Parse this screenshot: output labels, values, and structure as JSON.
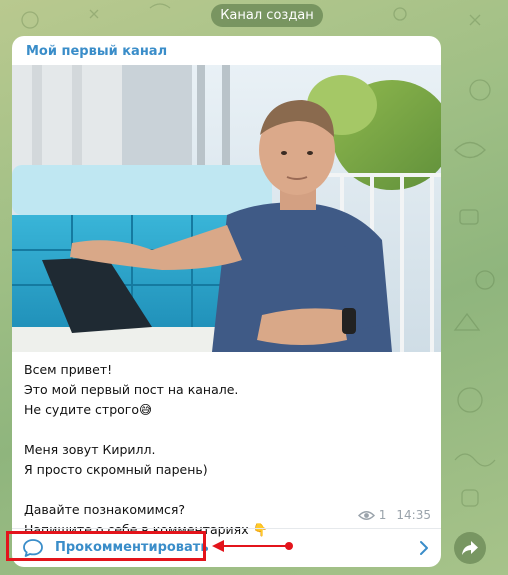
{
  "service_message": "Канал создан",
  "post": {
    "channel_name": "Мой первый канал",
    "text_lines": [
      "Всем привет!",
      "Это мой первый пост на канале.",
      "Не судите строго😅",
      "",
      "Меня зовут Кирилл.",
      "Я просто скромный парень)",
      "",
      "Давайте познакомимся?",
      "Напишите о себе в комментариях 👇"
    ],
    "views": "1",
    "time": "14:35"
  },
  "comments": {
    "label": "Прокомментировать"
  },
  "icons": {
    "views": "eye-icon",
    "comment": "comment-bubble-icon",
    "chevron": "chevron-right-icon",
    "share": "share-arrow-icon"
  },
  "colors": {
    "accent": "#3a8dc9",
    "highlight": "#e3141b",
    "meta": "#9aa3ab"
  }
}
